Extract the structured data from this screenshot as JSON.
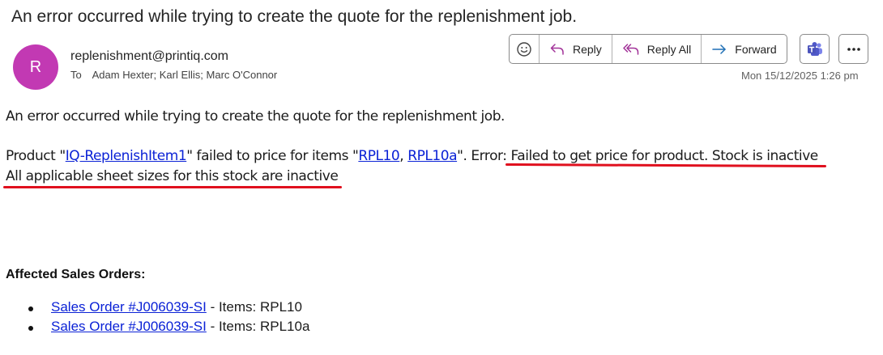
{
  "email": {
    "subject": "An error occurred while trying to create the quote for the replenishment job.",
    "avatar_initial": "R",
    "avatar_color": "#c239b3",
    "sender": "replenishment@printiq.com",
    "to_label": "To",
    "recipients": "Adam Hexter; Karl Ellis; Marc O'Connor",
    "date": "Mon 15/12/2025 1:26 pm"
  },
  "toolbar": {
    "reply_label": "Reply",
    "reply_all_label": "Reply All",
    "forward_label": "Forward"
  },
  "body": {
    "intro": "An error occurred while trying to create the quote for the replenishment job.",
    "product_prefix": "Product \"",
    "product_link": "IQ-ReplenishItem1",
    "product_mid": "\" failed to price for items \"",
    "item1_link": "RPL10",
    "item_sep": ", ",
    "item2_link": "RPL10a",
    "error_prefix": "\". Error",
    "error_msg": ": Failed to get price for product. Stock is inactive",
    "error_line2": "All applicable sheet sizes for this stock are inactive",
    "affected_heading": "Affected Sales Orders:",
    "orders": [
      {
        "link": "Sales Order #J006039-SI",
        "items": " - Items: RPL10"
      },
      {
        "link": "Sales Order #J006039-SI",
        "items": " - Items: RPL10a"
      }
    ]
  },
  "colors": {
    "link": "#0b22d6",
    "annotation": "#e0101e"
  }
}
